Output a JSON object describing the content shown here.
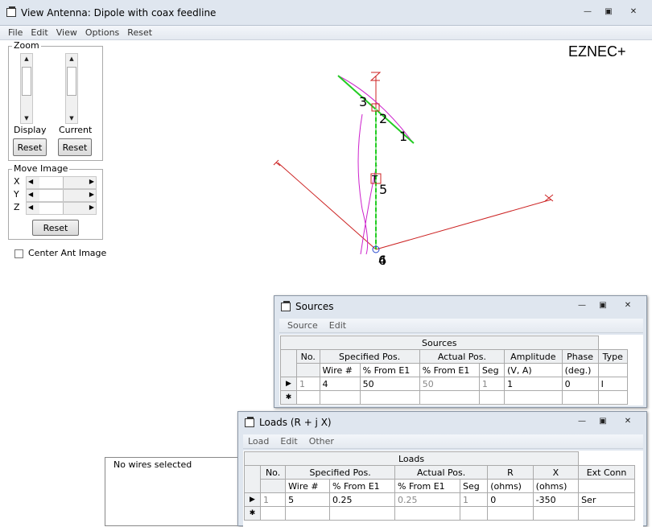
{
  "main_window": {
    "title": "View Antenna: Dipole with coax feedline",
    "menu": [
      "File",
      "Edit",
      "View",
      "Options",
      "Reset"
    ],
    "logo": "EZNEC+"
  },
  "zoom": {
    "label": "Zoom",
    "display_label": "Display",
    "current_label": "Current",
    "reset": "Reset"
  },
  "move_image": {
    "label": "Move Image",
    "axes": [
      "X",
      "Y",
      "Z"
    ],
    "reset": "Reset"
  },
  "center_ant": {
    "label": "Center Ant Image",
    "checked": false
  },
  "plot": {
    "axis_labels": {
      "z": "Z",
      "y": "Y",
      "x": "X"
    },
    "wire_labels": [
      "3",
      "2",
      "1",
      "5",
      "T",
      "4",
      "6"
    ]
  },
  "status_box": {
    "text": "No wires selected"
  },
  "sources_window": {
    "title": "Sources",
    "menu": [
      "Source",
      "Edit"
    ],
    "table_title": "Sources",
    "header1": [
      "No.",
      "Specified Pos.",
      "Actual Pos.",
      "Amplitude",
      "Phase",
      "Type"
    ],
    "header2": [
      "Wire #",
      "% From E1",
      "% From E1",
      "Seg",
      "(V, A)",
      "(deg.)"
    ],
    "rows": [
      {
        "no": "1",
        "wire": "4",
        "spec_pct": "50",
        "act_pct": "50",
        "seg": "1",
        "amp": "1",
        "phase": "0",
        "type": "I"
      }
    ]
  },
  "loads_window": {
    "title": "Loads (R + j X)",
    "menu": [
      "Load",
      "Edit",
      "Other"
    ],
    "table_title": "Loads",
    "header1": [
      "No.",
      "Specified Pos.",
      "Actual Pos.",
      "R",
      "X",
      "Ext Conn"
    ],
    "header2": [
      "Wire #",
      "% From E1",
      "% From E1",
      "Seg",
      "(ohms)",
      "(ohms)"
    ],
    "rows": [
      {
        "no": "1",
        "wire": "5",
        "spec_pct": "0.25",
        "act_pct": "0.25",
        "seg": "1",
        "r": "0",
        "x": "-350",
        "ext": "Ser"
      }
    ]
  },
  "colors": {
    "wire": "#22cc22",
    "axis": "#cc2222",
    "current": "#cc22cc",
    "title_bar": "#dfe6ef"
  }
}
